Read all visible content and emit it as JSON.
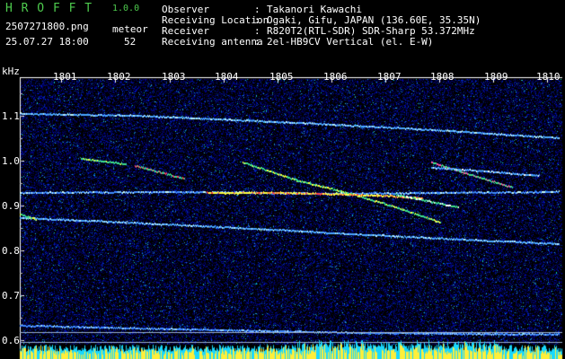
{
  "app": {
    "name": "H R O F F T",
    "version": "1.0.0"
  },
  "file": {
    "name": "2507271800.png",
    "datetime": "25.07.27 18:00"
  },
  "meteor": {
    "label": "meteor",
    "count": "52"
  },
  "info": [
    {
      "key": "Observer",
      "value": "Takanori Kawachi"
    },
    {
      "key": "Receiving Location",
      "value": "Ogaki, Gifu, JAPAN (136.60E, 35.35N)"
    },
    {
      "key": "Receiver",
      "value": "R820T2(RTL-SDR) SDR-Sharp 53.372MHz"
    },
    {
      "key": "Receiving antenna",
      "value": "2el-HB9CV Vertical (el. E-W)"
    }
  ],
  "axis": {
    "unit": "kHz",
    "time_labels": [
      "1801",
      "1802",
      "1803",
      "1804",
      "1805",
      "1806",
      "1807",
      "1808",
      "1809",
      "1810"
    ],
    "freq_labels": [
      "1.1",
      "1.0",
      "0.9",
      "0.8",
      "0.7",
      "0.6"
    ]
  },
  "colors": {
    "background": "#000000",
    "header_green": "#4ecb4e",
    "trace_blue": "#3c8cff",
    "hot_yellow": "#ffff00",
    "signal_strip_yellow": "#ffef3a",
    "signal_strip_cyan": "#18d8ff"
  }
}
